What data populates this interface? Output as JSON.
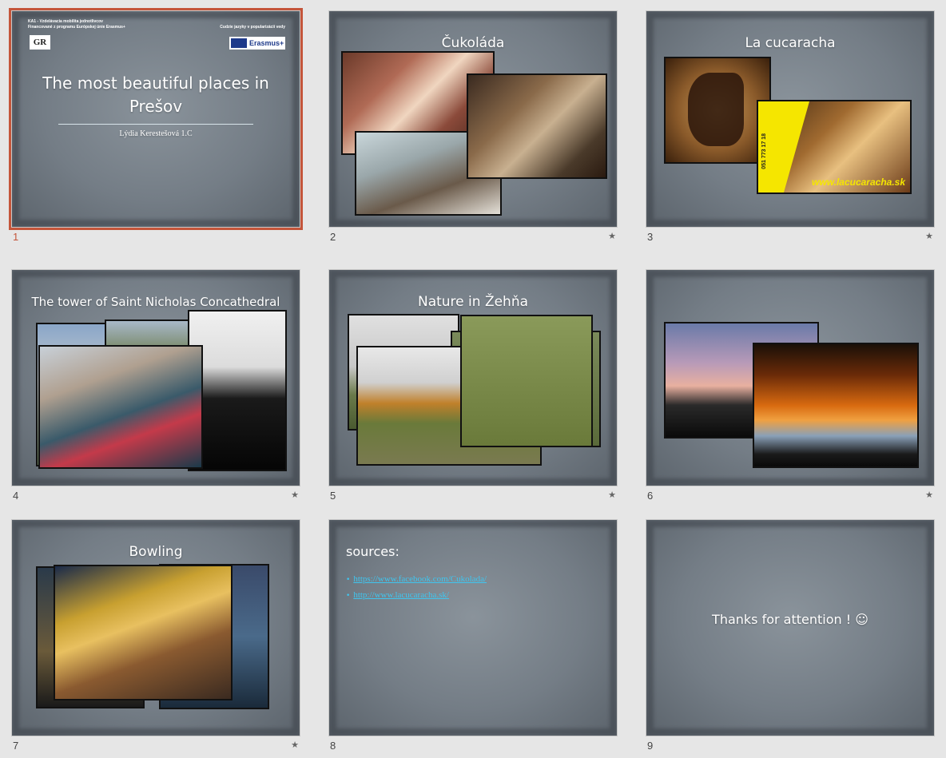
{
  "slides": [
    {
      "num": "1",
      "header_left_1": "KA1 - Vzdelávacia mobilita jednotlivcov",
      "header_left_2": "Financované z programu Európskej únie Erasmus+",
      "header_right": "Cudzie jazyky v popularizácii vedy",
      "logo_text": "GR",
      "erasmus_text": "Erasmus+",
      "title_line1": "The most beautiful places in",
      "title_line2": "Prešov",
      "subtitle": "Lýdia Kerestešová 1.C"
    },
    {
      "num": "2",
      "title": "Čukoláda",
      "star": "★"
    },
    {
      "num": "3",
      "title": "La cucaracha",
      "star": "★",
      "phone": "051 773 17 18",
      "web": "www.lacucaracha.sk"
    },
    {
      "num": "4",
      "title": "The tower of Saint Nicholas Concathedral",
      "star": "★"
    },
    {
      "num": "5",
      "title": "Nature in Žehňa",
      "star": "★"
    },
    {
      "num": "6",
      "star": "★"
    },
    {
      "num": "7",
      "title": "Bowling",
      "star": "★"
    },
    {
      "num": "8",
      "title": "sources:",
      "link1": "https://www.facebook.com/Cukolada/",
      "link2": "http://www.lacucaracha.sk/"
    },
    {
      "num": "9",
      "title": "Thanks for attention ! ☺"
    }
  ]
}
